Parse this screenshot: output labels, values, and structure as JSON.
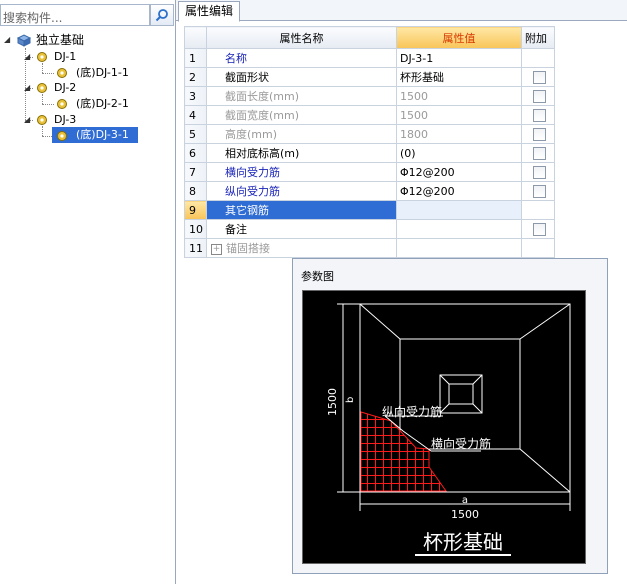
{
  "left_panel": {
    "search_placeholder": "搜索构件...",
    "tree": {
      "root": "独立基础",
      "items": [
        {
          "label": "DJ-1",
          "child": "(底)DJ-1-1"
        },
        {
          "label": "DJ-2",
          "child": "(底)DJ-2-1"
        },
        {
          "label": "DJ-3",
          "child": "(底)DJ-3-1"
        }
      ]
    }
  },
  "tab": {
    "label": "属性编辑"
  },
  "grid": {
    "headers": {
      "name": "属性名称",
      "value": "属性值",
      "extra": "附加"
    },
    "rows": [
      {
        "n": "1",
        "name": "名称",
        "value": "DJ-3-1"
      },
      {
        "n": "2",
        "name": "截面形状",
        "value": "杯形基础"
      },
      {
        "n": "3",
        "name": "截面长度(mm)",
        "value": "1500"
      },
      {
        "n": "4",
        "name": "截面宽度(mm)",
        "value": "1500"
      },
      {
        "n": "5",
        "name": "高度(mm)",
        "value": "1800"
      },
      {
        "n": "6",
        "name": "相对底标高(m)",
        "value": "(0)"
      },
      {
        "n": "7",
        "name": "横向受力筋",
        "value": "Φ12@200"
      },
      {
        "n": "8",
        "name": "纵向受力筋",
        "value": "Φ12@200"
      },
      {
        "n": "9",
        "name": "其它钢筋",
        "value": ""
      },
      {
        "n": "10",
        "name": "备注",
        "value": ""
      },
      {
        "n": "11",
        "name": "锚固搭接",
        "value": ""
      }
    ]
  },
  "param_panel": {
    "title": "参数图",
    "drawing": {
      "dim_left": "1500",
      "dim_bottom": "1500",
      "label_b": "b",
      "label_a": "a",
      "label_long": "纵向受力筋",
      "label_trans": "横向受力筋",
      "caption": "杯形基础"
    }
  }
}
